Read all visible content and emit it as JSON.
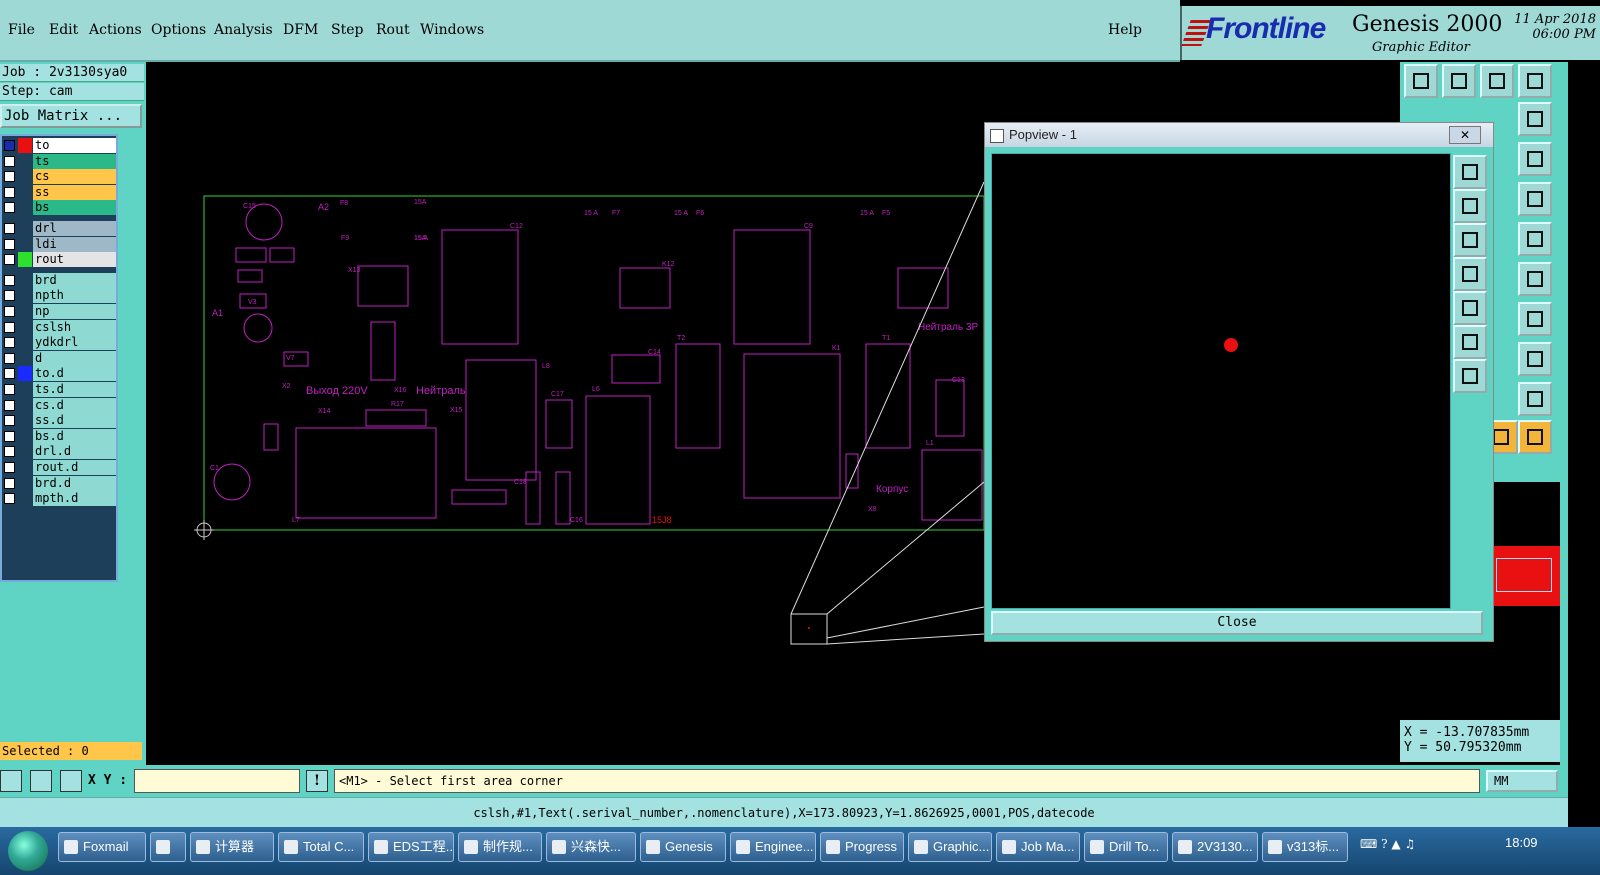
{
  "menu": {
    "items": [
      "File",
      "Edit",
      "Actions",
      "Options",
      "Analysis",
      "DFM",
      "Step",
      "Rout",
      "Windows"
    ],
    "help": "Help"
  },
  "brand": {
    "logo": "Frontline",
    "product": "Genesis 2000",
    "subtitle": "Graphic Editor",
    "date": "11 Apr 2018",
    "time": "06:00 PM"
  },
  "job": {
    "job_line": "Job : 2v3130sya0",
    "step_line": "Step: cam",
    "matrix_button": "Job Matrix ..."
  },
  "layers": [
    {
      "name": "to",
      "color": "#ffffff",
      "swatch": "#e81010",
      "check": "#1a2bb0"
    },
    {
      "name": "ts",
      "color": "#2bb98a",
      "swatch": "",
      "check": ""
    },
    {
      "name": "cs",
      "color": "#ffc64a",
      "swatch": "",
      "check": ""
    },
    {
      "name": "ss",
      "color": "#ffc64a",
      "swatch": "",
      "check": ""
    },
    {
      "name": "bs",
      "color": "#2bb98a",
      "swatch": "",
      "check": ""
    },
    {
      "name": "drl",
      "color": "#9fb8c8",
      "swatch": "",
      "check": ""
    },
    {
      "name": "ldi",
      "color": "#9fb8c8",
      "swatch": "",
      "check": ""
    },
    {
      "name": "rout",
      "color": "#e4e4e4",
      "swatch": "#2de02d",
      "check": ""
    },
    {
      "name": "brd",
      "color": "#8fd9d3",
      "swatch": "",
      "check": ""
    },
    {
      "name": "npth",
      "color": "#8fd9d3",
      "swatch": "",
      "check": ""
    },
    {
      "name": "np",
      "color": "#8fd9d3",
      "swatch": "",
      "check": ""
    },
    {
      "name": "cslsh",
      "color": "#8fd9d3",
      "swatch": "",
      "check": ""
    },
    {
      "name": "ydkdrl",
      "color": "#8fd9d3",
      "swatch": "",
      "check": ""
    },
    {
      "name": "d",
      "color": "#8fd9d3",
      "swatch": "",
      "check": ""
    },
    {
      "name": "to.d",
      "color": "#8fd9d3",
      "swatch": "#1a2bff",
      "check": ""
    },
    {
      "name": "ts.d",
      "color": "#8fd9d3",
      "swatch": "",
      "check": ""
    },
    {
      "name": "cs.d",
      "color": "#8fd9d3",
      "swatch": "",
      "check": ""
    },
    {
      "name": "ss.d",
      "color": "#8fd9d3",
      "swatch": "",
      "check": ""
    },
    {
      "name": "bs.d",
      "color": "#8fd9d3",
      "swatch": "",
      "check": ""
    },
    {
      "name": "drl.d",
      "color": "#8fd9d3",
      "swatch": "",
      "check": ""
    },
    {
      "name": "rout.d",
      "color": "#8fd9d3",
      "swatch": "",
      "check": ""
    },
    {
      "name": "brd.d",
      "color": "#8fd9d3",
      "swatch": "",
      "check": ""
    },
    {
      "name": "mpth.d",
      "color": "#8fd9d3",
      "swatch": "",
      "check": ""
    }
  ],
  "selected": "Selected : 0",
  "board": {
    "labels": [
      "C15",
      "A2",
      "F8",
      "15A",
      "C12",
      "15 A",
      "F7",
      "15 A",
      "F6",
      "C9",
      "15 A",
      "F5",
      "15 A",
      "F9",
      "15A",
      "A1",
      "X13",
      "K12",
      "X2",
      "Выход 220V",
      "Нейтраль",
      "Нейтраль 3P",
      "Корпус",
      "15J8",
      "C1",
      "L7",
      "K1",
      "T1",
      "T2",
      "C14",
      "L6",
      "L8",
      "C17",
      "C18",
      "C16",
      "C13",
      "L1",
      "X8",
      "V7",
      "V3",
      "R17",
      "X14",
      "X16",
      "X15"
    ]
  },
  "popview": {
    "title": "Popview - 1",
    "close_label": "Close",
    "close_x": "✕"
  },
  "coords": {
    "x": "X = -13.707835mm",
    "y": "Y = 50.795320mm"
  },
  "cmd": {
    "xy_label": "X Y :",
    "xy_value": "",
    "prompt": "<M1> - Select first area corner",
    "units": "MM",
    "bang": "!"
  },
  "status": "cslsh,#1,Text(.serival_number,.nomenclature),X=173.80923,Y=1.8626925,0001,POS,datecode",
  "taskbar": {
    "tasks": [
      "Foxmail",
      "",
      "计算器",
      "Total C...",
      "EDS工程...",
      "制作规...",
      "兴森快...",
      "Genesis",
      "Enginee...",
      "Progress",
      "Graphic...",
      "Job Ma...",
      "Drill To...",
      "2V3130...",
      "v313标..."
    ],
    "clock": "18:09"
  },
  "colors": {
    "panel": "#5fd3c4",
    "menu": "#9fd9d5",
    "board_outline": "#35d035",
    "component": "#c020c0",
    "highlight": "#e81010"
  }
}
